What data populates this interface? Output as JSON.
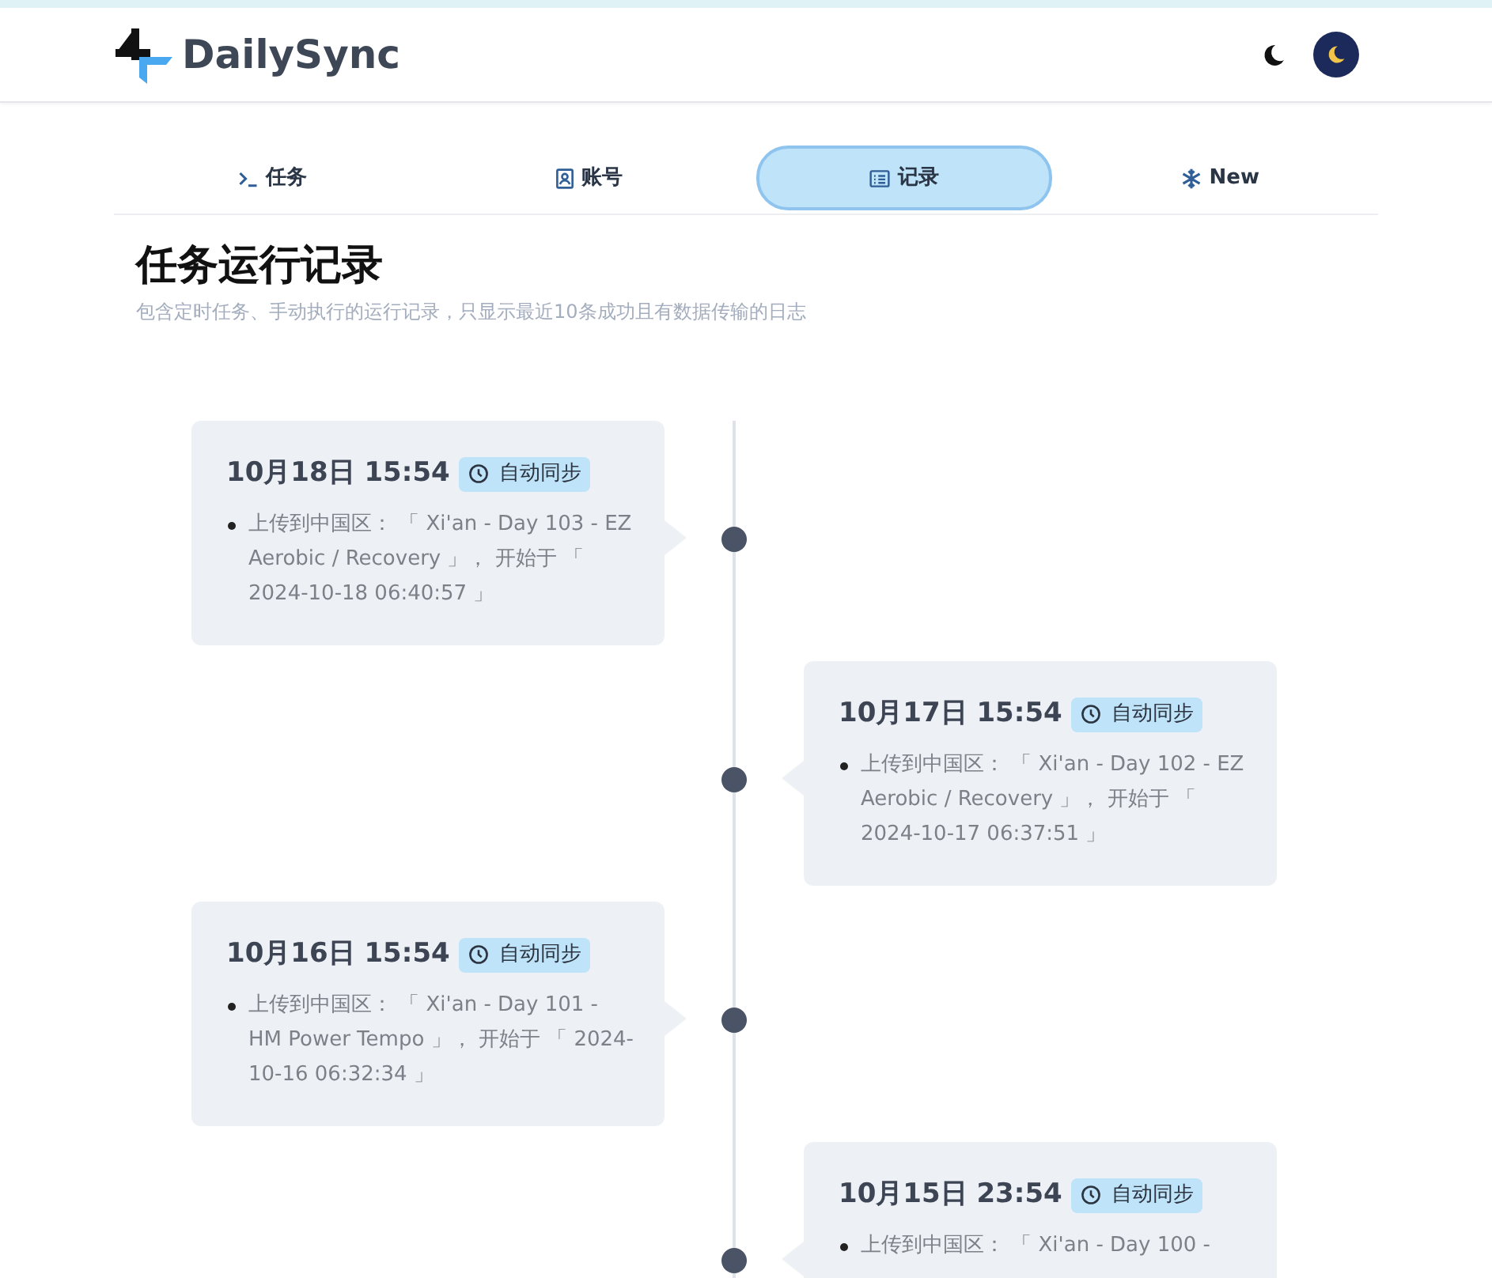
{
  "header": {
    "brand": "DailySync"
  },
  "tabs": [
    {
      "label": "任务",
      "selected": false
    },
    {
      "label": "账号",
      "selected": false
    },
    {
      "label": "记录",
      "selected": true
    },
    {
      "label": "New",
      "selected": false
    }
  ],
  "page": {
    "title": "任务运行记录",
    "subtitle": "包含定时任务、手动执行的运行记录，只显示最近10条成功且有数据传输的日志"
  },
  "records": [
    {
      "time": "10月18日 15:54",
      "tag": "自动同步",
      "items": [
        "上传到中国区： 「 Xi'an - Day 103 - EZ Aerobic / Recovery 」， 开始于 「 2024-10-18 06:40:57 」"
      ]
    },
    {
      "time": "10月17日 15:54",
      "tag": "自动同步",
      "items": [
        "上传到中国区： 「 Xi'an - Day 102 - EZ Aerobic / Recovery 」， 开始于 「 2024-10-17 06:37:51 」"
      ]
    },
    {
      "time": "10月16日 15:54",
      "tag": "自动同步",
      "items": [
        "上传到中国区： 「 Xi'an - Day 101 - HM Power Tempo 」， 开始于 「 2024-10-16 06:32:34 」"
      ]
    },
    {
      "time": "10月15日 23:54",
      "tag": "自动同步",
      "items": [
        "上传到中国区： 「 Xi'an - Day 100 -"
      ]
    }
  ]
}
